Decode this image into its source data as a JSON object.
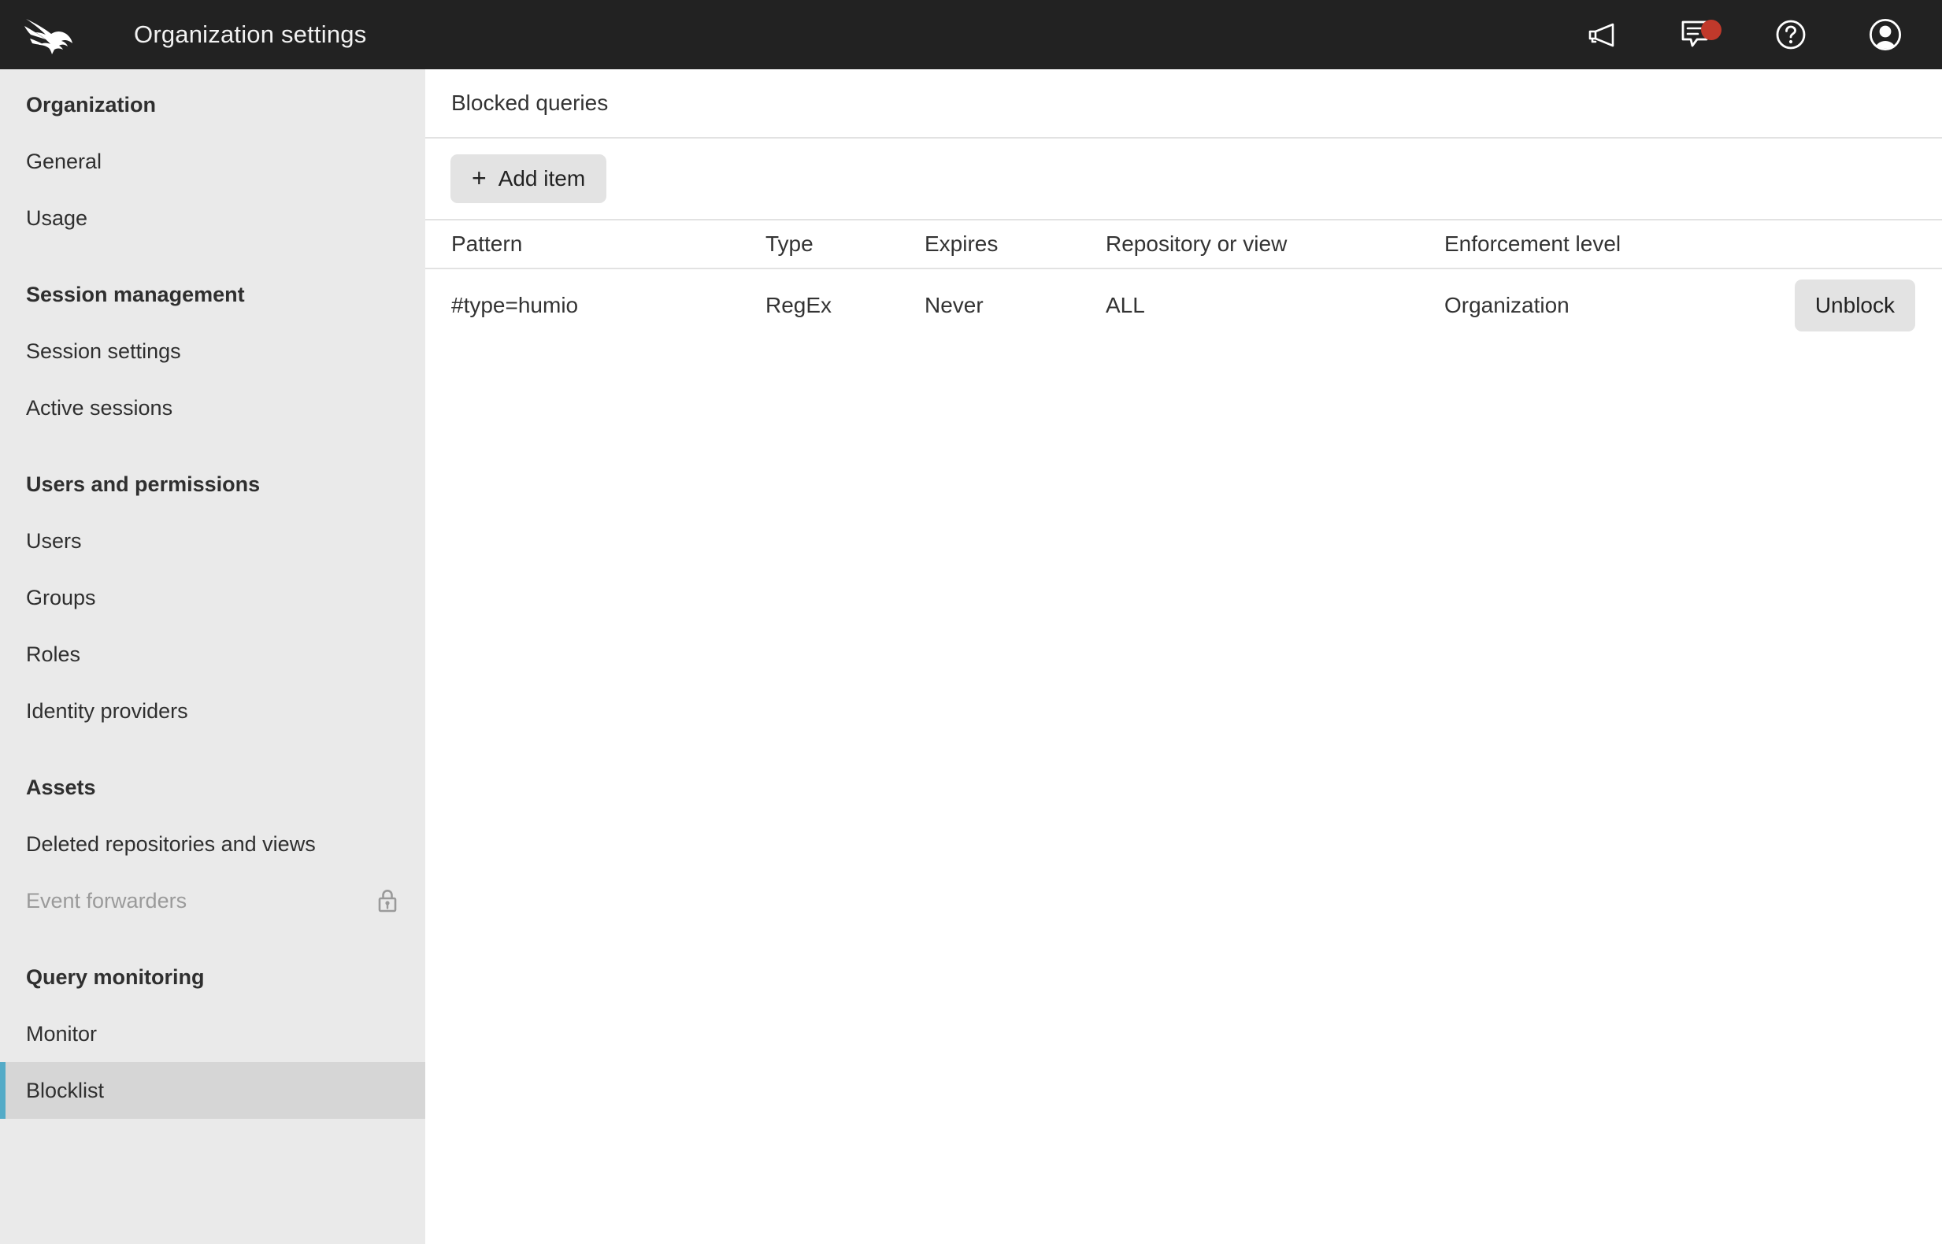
{
  "topbar": {
    "logo_name": "crowdstrike-falcon-logo",
    "title": "Organization settings",
    "icons": [
      {
        "name": "megaphone-icon",
        "label": "Announcements",
        "badge": false
      },
      {
        "name": "chat-icon",
        "label": "Messages",
        "badge": true
      },
      {
        "name": "help-icon",
        "label": "Help",
        "badge": false
      },
      {
        "name": "user-avatar-icon",
        "label": "Account",
        "badge": false
      }
    ],
    "badge_color": "#c0392b",
    "background": "#222222"
  },
  "sidebar": {
    "background": "#eaeaea",
    "active_accent_color": "#54abc7",
    "active_background": "#d6d6d6",
    "groups": [
      {
        "title": "Organization",
        "items": [
          {
            "label": "General",
            "state": "normal"
          },
          {
            "label": "Usage",
            "state": "normal"
          }
        ]
      },
      {
        "title": "Session management",
        "items": [
          {
            "label": "Session settings",
            "state": "normal"
          },
          {
            "label": "Active sessions",
            "state": "normal"
          }
        ]
      },
      {
        "title": "Users and permissions",
        "items": [
          {
            "label": "Users",
            "state": "normal"
          },
          {
            "label": "Groups",
            "state": "normal"
          },
          {
            "label": "Roles",
            "state": "normal"
          },
          {
            "label": "Identity providers",
            "state": "normal"
          }
        ]
      },
      {
        "title": "Assets",
        "items": [
          {
            "label": "Deleted repositories and views",
            "state": "normal"
          },
          {
            "label": "Event forwarders",
            "state": "disabled",
            "icon": "lock-icon"
          }
        ]
      },
      {
        "title": "Query monitoring",
        "items": [
          {
            "label": "Monitor",
            "state": "normal"
          },
          {
            "label": "Blocklist",
            "state": "active"
          }
        ]
      }
    ]
  },
  "main": {
    "header_title": "Blocked queries",
    "add_button": {
      "label": "Add item",
      "icon": "plus-icon"
    },
    "table": {
      "columns": [
        "Pattern",
        "Type",
        "Expires",
        "Repository or view",
        "Enforcement level",
        ""
      ],
      "rows": [
        {
          "pattern": "#type=humio",
          "type": "RegEx",
          "expires": "Never",
          "repository": "ALL",
          "enforcement": "Organization",
          "action_label": "Unblock"
        }
      ]
    }
  }
}
